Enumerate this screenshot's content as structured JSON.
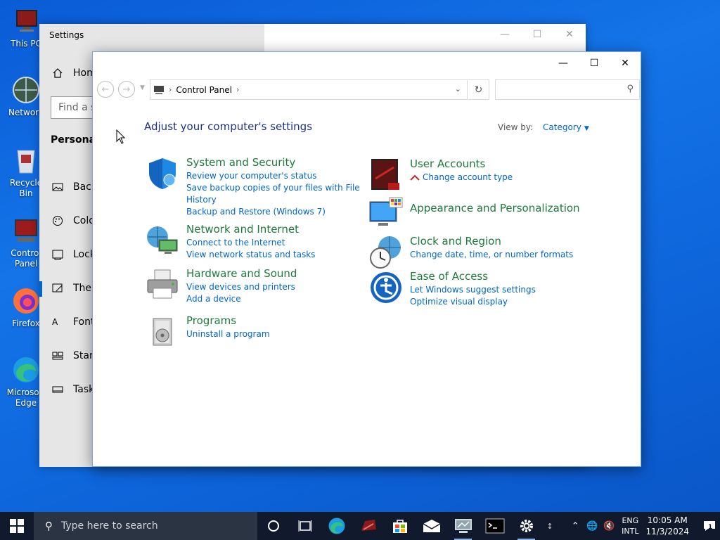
{
  "desktop": {
    "icons": [
      {
        "label": "This PC",
        "icon": "computer-icon"
      },
      {
        "label": "Network",
        "icon": "network-icon"
      },
      {
        "label": "Recycle Bin",
        "icon": "recycle-bin-icon"
      },
      {
        "label": "Control Panel",
        "icon": "control-panel-icon"
      },
      {
        "label": "Firefox",
        "icon": "firefox-icon"
      },
      {
        "label": "Microsoft Edge",
        "icon": "edge-icon"
      }
    ]
  },
  "settings": {
    "title": "Settings",
    "home_label": "Home",
    "find_placeholder": "Find a s",
    "section_title": "Personaliz",
    "nav_items": [
      "Back",
      "Colo",
      "Lock",
      "Then",
      "Fonts",
      "Start",
      "Taskb"
    ],
    "active_index": 3
  },
  "control_panel": {
    "address": {
      "crumb": "Control Panel"
    },
    "heading": "Adjust your computer's settings",
    "view_by_label": "View by:",
    "view_by_value": "Category",
    "categories": {
      "system_security": {
        "title": "System and Security",
        "links": [
          "Review your computer's status",
          "Save backup copies of your files with File",
          "History",
          "Backup and Restore (Windows 7)"
        ]
      },
      "network_internet": {
        "title": "Network and Internet",
        "links": [
          "Connect to the Internet",
          "View network status and tasks"
        ]
      },
      "hardware_sound": {
        "title": "Hardware and Sound",
        "links": [
          "View devices and printers",
          "Add a device"
        ]
      },
      "programs": {
        "title": "Programs",
        "links": [
          "Uninstall a program"
        ]
      },
      "user_accounts": {
        "title": "User Accounts",
        "links": [
          "Change account type"
        ]
      },
      "appearance": {
        "title": "Appearance and Personalization",
        "links": []
      },
      "clock_region": {
        "title": "Clock and Region",
        "links": [
          "Change date, time, or number formats"
        ]
      },
      "ease_access": {
        "title": "Ease of Access",
        "links": [
          "Let Windows suggest settings",
          "Optimize visual display"
        ]
      }
    }
  },
  "taskbar": {
    "search_placeholder": "Type here to search",
    "apps": [
      "task-view-icon",
      "edge-icon",
      "app-icon",
      "store-icon",
      "mail-icon",
      "control-panel-icon",
      "terminal-icon",
      "settings-icon"
    ],
    "lang_line1": "ENG",
    "lang_line2": "INTL",
    "time": "10:05 AM",
    "date": "11/3/2024",
    "notification_count": "1"
  }
}
